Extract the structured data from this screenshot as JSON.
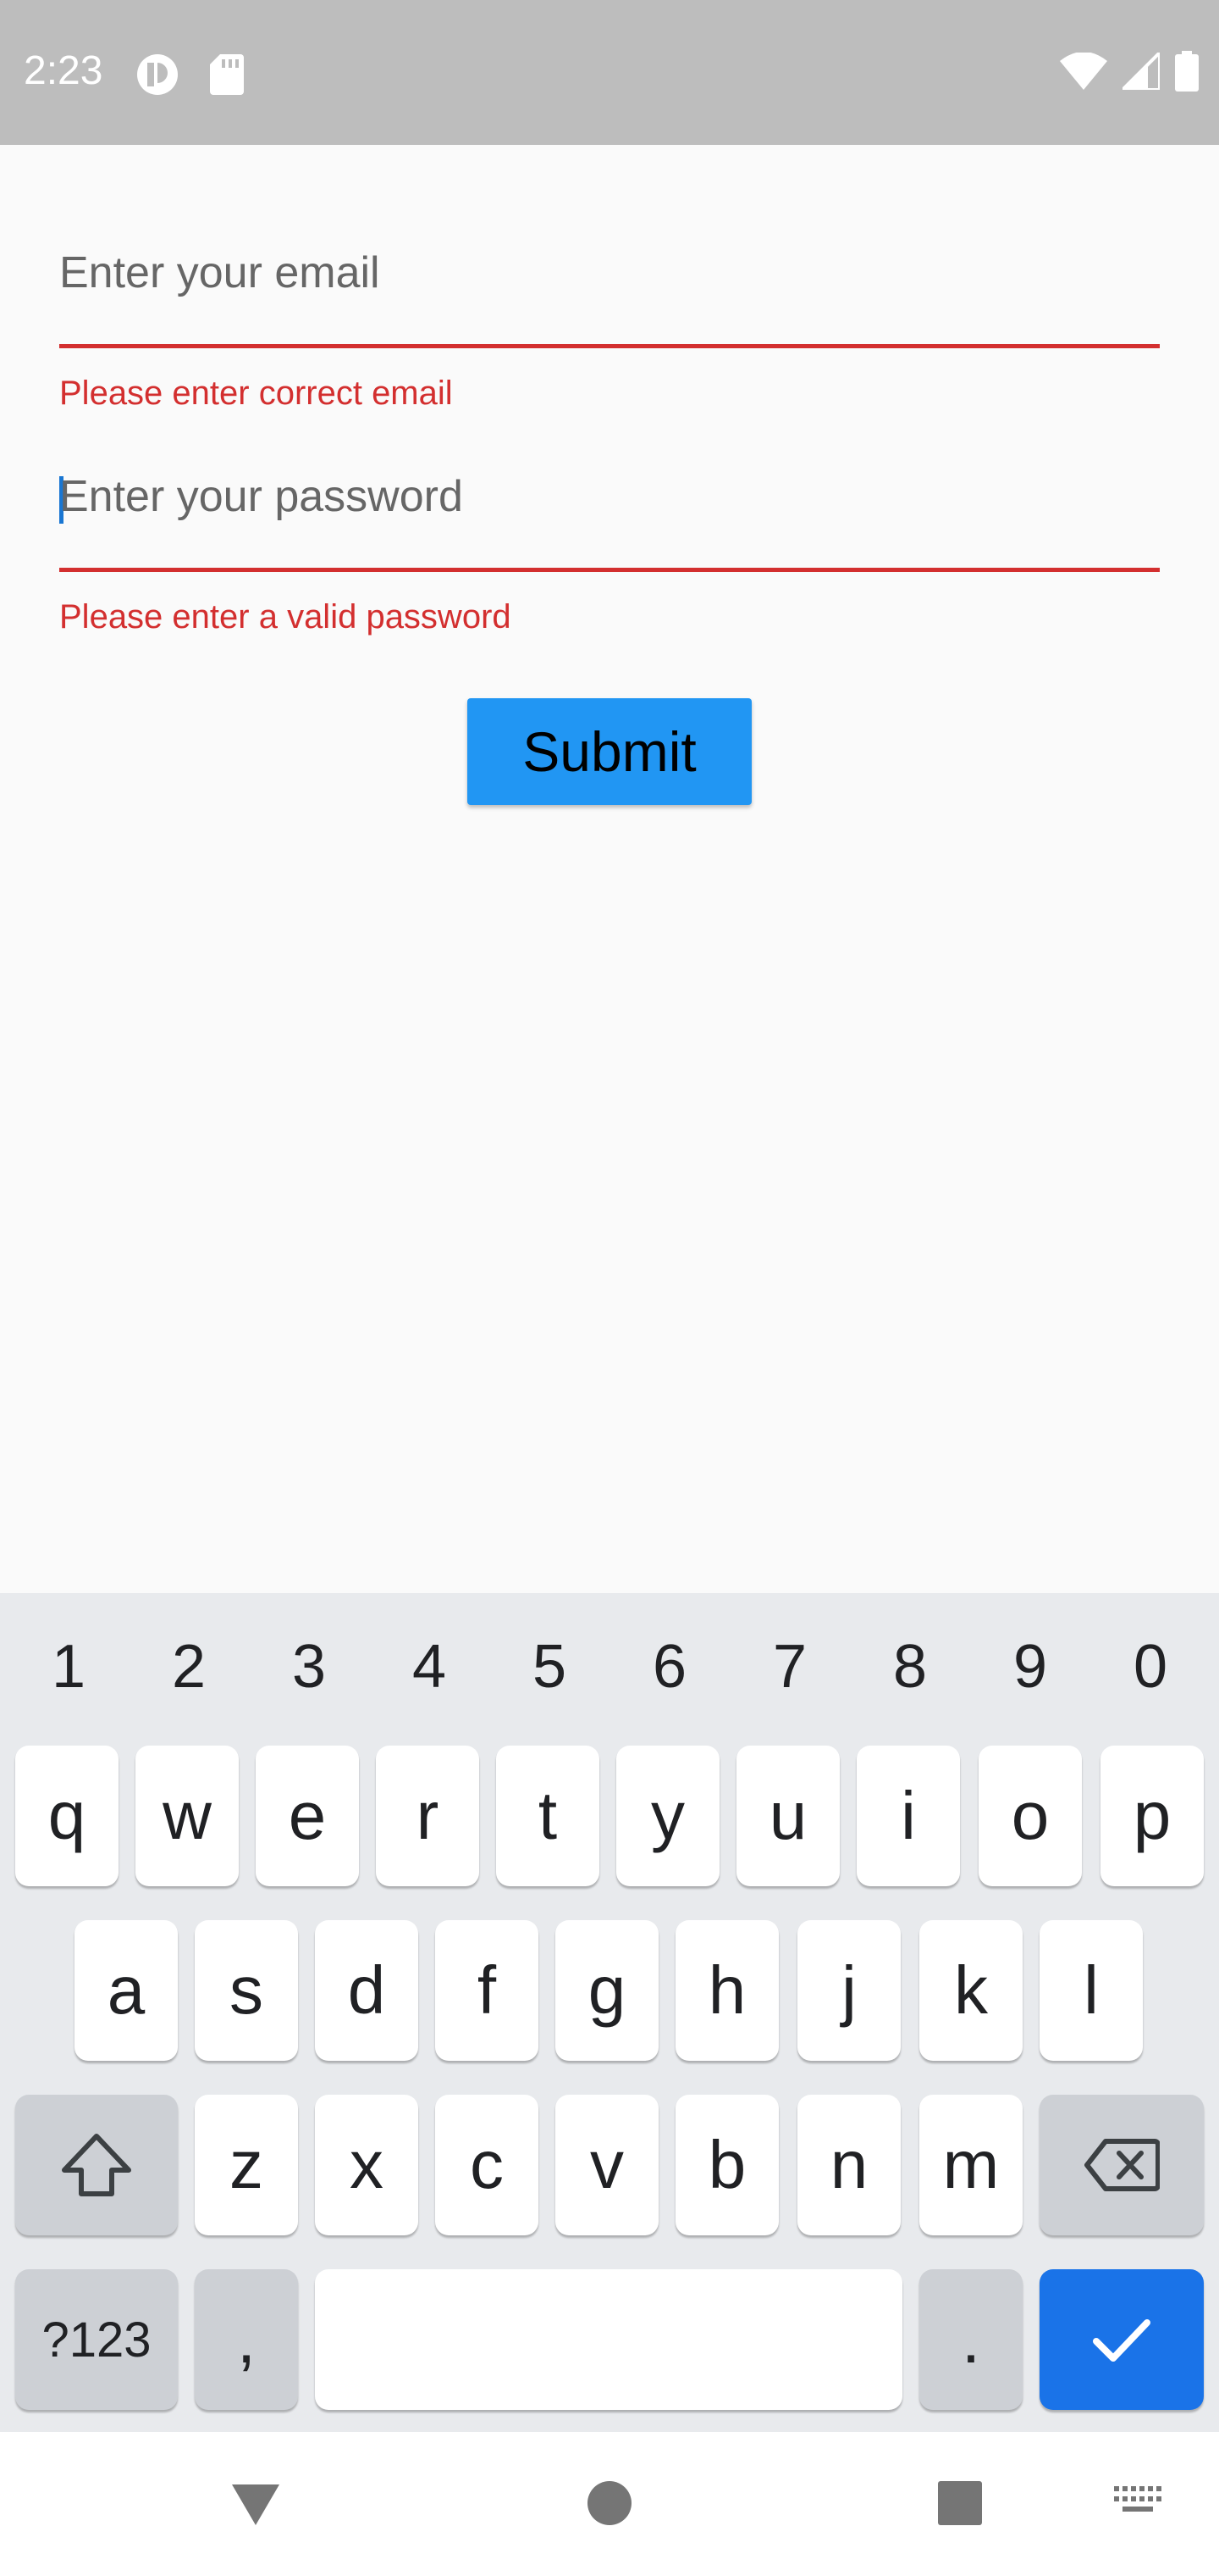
{
  "status_bar": {
    "time": "2:23",
    "left_icons": [
      "app-notification-icon",
      "sd-card-icon"
    ],
    "right_icons": [
      "wifi-icon",
      "cell-signal-icon",
      "battery-icon"
    ]
  },
  "form": {
    "email": {
      "placeholder": "Enter your email",
      "error": "Please enter correct email"
    },
    "password": {
      "placeholder": "Enter your password",
      "error": "Please enter a valid password"
    },
    "submit_label": "Submit"
  },
  "colors": {
    "error": "#d32f2f",
    "button": "#2196f3",
    "status_bar": "#bdbdbd",
    "keyboard_action": "#1a73e8"
  },
  "keyboard": {
    "numbers": [
      "1",
      "2",
      "3",
      "4",
      "5",
      "6",
      "7",
      "8",
      "9",
      "0"
    ],
    "row1": [
      "q",
      "w",
      "e",
      "r",
      "t",
      "y",
      "u",
      "i",
      "o",
      "p"
    ],
    "row2": [
      "a",
      "s",
      "d",
      "f",
      "g",
      "h",
      "j",
      "k",
      "l"
    ],
    "row3": [
      "z",
      "x",
      "c",
      "v",
      "b",
      "n",
      "m"
    ],
    "symbols_label": "?123",
    "comma_label": ",",
    "period_label": "."
  },
  "nav_bar": {
    "icons": [
      "back-icon",
      "home-icon",
      "recents-icon",
      "keyboard-switch-icon"
    ]
  }
}
